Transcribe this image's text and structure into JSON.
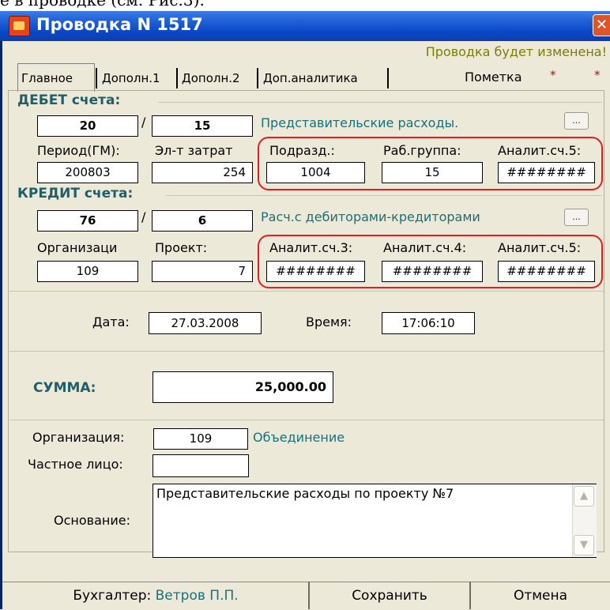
{
  "caption_fragment": "е в проводке (см. Рис.3).",
  "window": {
    "title": "Проводка N 1517",
    "close_glyph": "✕",
    "status": "Проводка будет изменена!"
  },
  "tabs": [
    {
      "label": "Главное",
      "active": true
    },
    {
      "label": "Дополн.1",
      "active": false
    },
    {
      "label": "Дополн.2",
      "active": false
    },
    {
      "label": "Доп.аналитика",
      "active": false
    }
  ],
  "mark": {
    "label": "Пометка",
    "star": "*"
  },
  "debit": {
    "heading": "ДЕБЕТ счета:",
    "account": "20",
    "slash": "/",
    "subaccount": "15",
    "account_name": "Представительские расходы.",
    "button_label": "...",
    "fields": [
      {
        "label": "Период(ГМ):",
        "value": "200803"
      },
      {
        "label": "Эл-т затрат",
        "value": "254"
      },
      {
        "label": "Подразд.:",
        "value": "1004"
      },
      {
        "label": "Раб.группа:",
        "value": "15"
      },
      {
        "label": "Аналит.сч.5:",
        "value": "########"
      }
    ]
  },
  "credit": {
    "heading": "КРЕДИТ счета:",
    "account": "76",
    "slash": "/",
    "subaccount": "6",
    "account_name": "Расч.с дебиторами-кредиторами",
    "button_label": "...",
    "fields": [
      {
        "label": "Организаци",
        "value": "109"
      },
      {
        "label": "Проект:",
        "value": "7"
      },
      {
        "label": "Аналит.сч.3:",
        "value": "########"
      },
      {
        "label": "Аналит.сч.4:",
        "value": "########"
      },
      {
        "label": "Аналит.сч.5:",
        "value": "########"
      }
    ]
  },
  "datetime": {
    "date_label": "Дата:",
    "date_value": "27.03.2008",
    "time_label": "Время:",
    "time_value": "17:06:10"
  },
  "sum": {
    "label": "СУММА:",
    "value": "25,000.00"
  },
  "counterparty": {
    "org_label": "Организация:",
    "org_value": "109",
    "org_name": "Объединение",
    "person_label": "Частное лицо:",
    "person_value": "",
    "basis_label": "Основание:",
    "basis_value": "Представительские расходы по проекту №7"
  },
  "footer": {
    "accountant_label": "Бухгалтер:",
    "accountant_name": "Ветров П.П.",
    "save_label": "Сохранить",
    "cancel_label": "Отмена"
  },
  "colors": {
    "title_bar": "#1f5fd6",
    "teal_text": "#18707a",
    "highlight_red": "#e0201e",
    "status_olive": "#7c7c08"
  }
}
